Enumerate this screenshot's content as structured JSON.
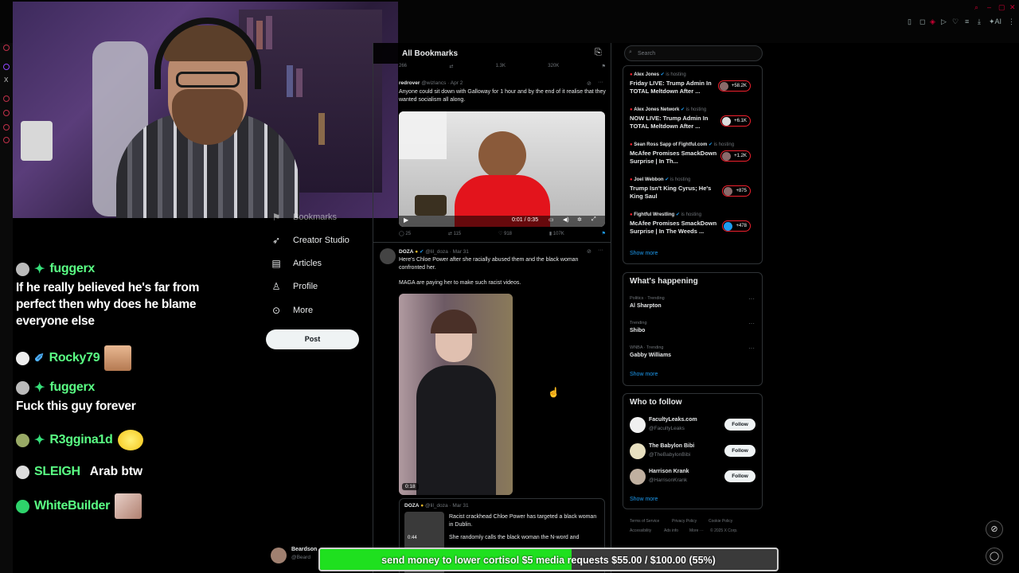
{
  "chat": {
    "messages": [
      {
        "user": "fuggerx",
        "text": "If he really believed he's far from perfect then why does he blame everyone else"
      },
      {
        "user": "Rocky79",
        "text": ""
      },
      {
        "user": "fuggerx",
        "text": "Fuck this guy forever"
      },
      {
        "user": "R3ggina1d",
        "text": ""
      },
      {
        "user": "SLEIGH",
        "text": "Arab btw"
      },
      {
        "user": "WhiteBuilder",
        "text": ""
      }
    ]
  },
  "nav": {
    "bookmarks": "Bookmarks",
    "creator_studio": "Creator Studio",
    "articles": "Articles",
    "profile": "Profile",
    "more": "More",
    "post": "Post"
  },
  "bottom_user": {
    "name": "Beardson",
    "handle": "@Beard"
  },
  "feed": {
    "title": "All Bookmarks",
    "top_counts": {
      "replies": "266",
      "reposts": "",
      "likes": "1.3K",
      "views": "320K"
    },
    "tweet1": {
      "name": "redrover",
      "handle": "@wizlancs",
      "date": "Apr 2",
      "text": "Anyone could sit down with Galloway for 1 hour and by the end of it realise that they wanted socialism all along.",
      "video_time": "0:01 / 0:35",
      "replies": "25",
      "reposts": "115",
      "likes": "918",
      "views": "107K"
    },
    "tweet2": {
      "name": "DOZA",
      "handle": "@lil_doza",
      "date": "Mar 31",
      "text": "Here's Chloe Power after she racially abused them and the black woman confronted her.",
      "text2": "MAGA are paying her to make such racist videos.",
      "video_duration": "0:18",
      "quote_name": "DOZA",
      "quote_handle": "@lil_doza",
      "quote_date": "Mar 31",
      "quote_text": "Racist crackhead Chloe Power has targeted a black woman in Dublin.",
      "quote_text2": "She randomly calls the black woman the N-word and",
      "quote_duration": "0:44"
    }
  },
  "right": {
    "search_placeholder": "Search",
    "live": [
      {
        "host": "Alex Jones",
        "hosting": "is hosting",
        "title": "Friday LIVE: Trump Admin In TOTAL Meltdown After ...",
        "count": "+58.2K"
      },
      {
        "host": "Alex Jones Network",
        "hosting": "is hosting",
        "title": "NOW LIVE: Trump Admin In TOTAL Meltdown After ...",
        "count": "+6.1K"
      },
      {
        "host": "Sean Ross Sapp of Fightful.com",
        "hosting": "is hosting",
        "title": "McAfee Promises SmackDown Surprise | In Th...",
        "count": "+1.2K"
      },
      {
        "host": "Joel Webbon",
        "hosting": "is hosting",
        "title": "Trump Isn't King Cyrus; He's King Saul",
        "count": "+875"
      },
      {
        "host": "Fightful Wrestling",
        "hosting": "is hosting",
        "title": "McAfee Promises SmackDown Surprise | In The Weeds ...",
        "count": "+478"
      }
    ],
    "show_more": "Show more",
    "whats_happening": "What's happening",
    "trends": [
      {
        "category": "Politics · Trending",
        "name": "Al Sharpton"
      },
      {
        "category": "Trending",
        "name": "Shibo"
      },
      {
        "category": "WNBA · Trending",
        "name": "Gabby Williams"
      }
    ],
    "who_to_follow": "Who to follow",
    "follow_label": "Follow",
    "follows": [
      {
        "name": "FacultyLeaks.com",
        "handle": "@FacultyLeaks"
      },
      {
        "name": "The Babylon Bibi",
        "handle": "@TheBabylonBibi"
      },
      {
        "name": "Harrison Krank",
        "handle": "@HarrisonKrank"
      }
    ],
    "footer": [
      "Terms of Service",
      "Privacy Policy",
      "Cookie Policy",
      "Accessibility",
      "Ads info",
      "More ···",
      "© 2025 X Corp."
    ]
  },
  "donation": {
    "text": "send money to lower cortisol $5 media requests $55.00 / $100.00 (55%)",
    "progress": 0.55,
    "fill_color": "#1fe01f"
  },
  "browser": {
    "ai_label": "AI"
  }
}
